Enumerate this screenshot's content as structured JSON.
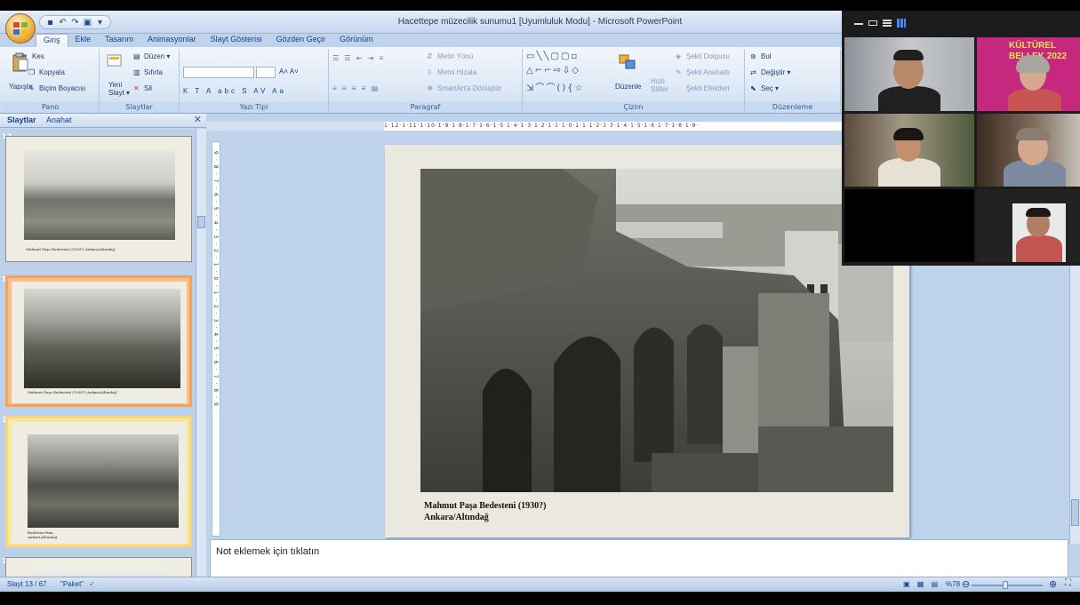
{
  "window": {
    "title": "Hacettepe müzecilik sunumu1 [Uyumluluk Modu] - Microsoft PowerPoint"
  },
  "tabs": [
    "Giriş",
    "Ekle",
    "Tasarım",
    "Animasyonlar",
    "Slayt Gösterisi",
    "Gözden Geçir",
    "Görünüm"
  ],
  "ribbon": {
    "pano": {
      "label": "Pano",
      "paste": "Yapıştır",
      "cut": "Kes",
      "copy": "Kopyala",
      "format_painter": "Biçim Boyacısı"
    },
    "slaytlar": {
      "label": "Slaytlar",
      "new_slide_1": "Yeni",
      "new_slide_2": "Slayt",
      "layout": "Düzen",
      "reset": "Sıfırla",
      "delete": "Sil"
    },
    "yazi_tipi": {
      "label": "Yazı Tipi"
    },
    "paragraf": {
      "label": "Paragraf",
      "text_direction": "Metin Yönü",
      "align_text": "Metni Hizala",
      "smartart": "SmartArt'a Dönüştür"
    },
    "cizim": {
      "label": "Çizim",
      "arrange": "Düzenle",
      "quick_styles_1": "Hızlı",
      "quick_styles_2": "Stiller",
      "shape_fill": "Şekil Dolgusu",
      "shape_outline": "Şekil Anahattı",
      "shape_effects": "Şekil Efektleri"
    },
    "duzenleme": {
      "label": "Düzenleme",
      "find": "Bul",
      "replace": "Değiştir",
      "select": "Seç"
    }
  },
  "left_pane": {
    "tab_slides": "Slaytlar",
    "tab_outline": "Anahat",
    "thumbnails": [
      {
        "number": "12",
        "caption": "Mahmut Paşa Bedesteni (1930?) Ankara/Altındağ"
      },
      {
        "number": "13",
        "caption": "Mahmut Paşa Bedesteni (1930?) Ankara/Altındağ"
      },
      {
        "number": "14",
        "caption": "Bedesten-Han Ankara/Altındağ"
      },
      {
        "number": "15",
        "caption": ""
      }
    ]
  },
  "ruler": {
    "horizontal": "1·12·1·11·1·10·1·9·1·8·1·7·1·6·1·5·1·4·1·3·1·2·1·1·1·0·1·1·1·2·1·3·1·4·1·5·1·6·1·7·1·8·1·9·",
    "vertical": "9·8·7·6·5·4·3·2·1·0·1·2·3·4·5·6·7·8·9"
  },
  "slide": {
    "caption_line1": "Mahmut Paşa Bedesteni (1930?)",
    "caption_line2": "Ankara/Altındağ"
  },
  "notes": {
    "placeholder": "Not eklemek için tıklatın"
  },
  "status": {
    "slide_position": "Slayt 13 / 67",
    "theme": "\"Paket\"",
    "zoom": "%78"
  },
  "call": {
    "banner_text_1": "KÜLTÜREL",
    "banner_text_2": "BELLEK 2022"
  },
  "colors": {
    "ribbon_blue": "#bfd3ea",
    "selected_thumb": "#f3a35d",
    "active_speaker": "#c8e63b"
  }
}
